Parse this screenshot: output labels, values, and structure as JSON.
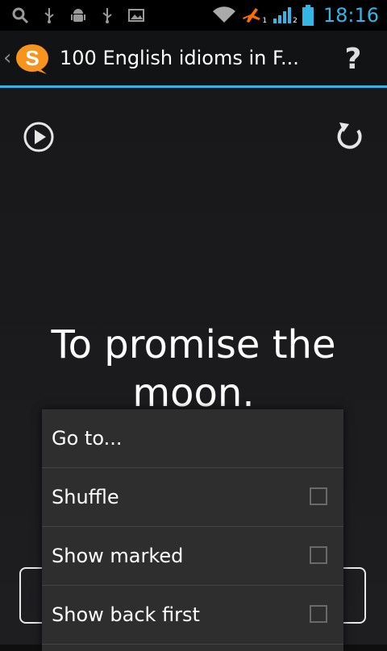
{
  "status_bar": {
    "time": "18:16",
    "notification_icons": [
      "search-icon",
      "usb-icon",
      "android-debug-icon",
      "usb-icon",
      "image-icon"
    ],
    "system_icons": [
      "wifi-icon",
      "airplane-mode-icon",
      "signal-icon",
      "battery-icon"
    ],
    "sim_labels": [
      "1",
      "2"
    ]
  },
  "action_bar": {
    "logo_letter": "S",
    "title": "100 English idioms in F...",
    "help_label": "?"
  },
  "card": {
    "text": "To promise the moon."
  },
  "menu": {
    "items": [
      {
        "label": "Go to...",
        "has_checkbox": false
      },
      {
        "label": "Shuffle",
        "has_checkbox": true,
        "checked": false
      },
      {
        "label": "Show marked",
        "has_checkbox": true,
        "checked": false
      },
      {
        "label": "Show back first",
        "has_checkbox": true,
        "checked": false
      }
    ]
  },
  "colors": {
    "accent": "#33b5e5",
    "logo": "#f7941d",
    "airplane": "#ff6d00"
  }
}
